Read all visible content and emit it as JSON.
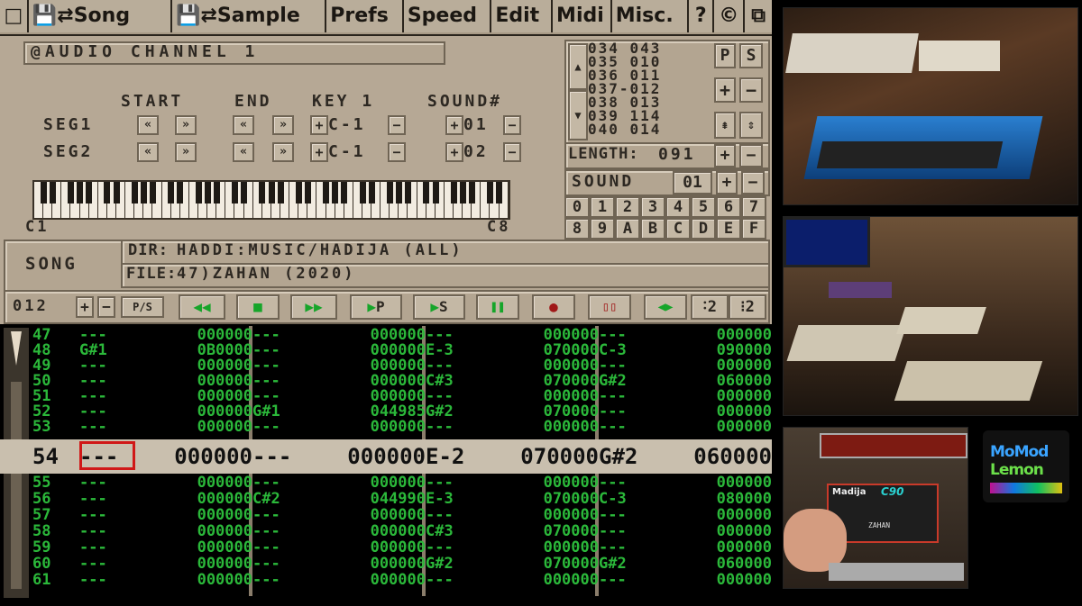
{
  "menu": [
    "□",
    "💾⇄Song",
    "💾⇄Sample",
    "Prefs",
    "Speed",
    "Edit",
    "Midi",
    "Misc.",
    "?",
    "©",
    "⧉"
  ],
  "channel_title": "@AUDIO CHANNEL 1",
  "positions": [
    "034 043",
    "035 010",
    "036 011",
    "037-012",
    "038 013",
    "039 114",
    "040 014"
  ],
  "pos_buttons": {
    "p": "P",
    "s": "S",
    "plus": "+",
    "minus": "−"
  },
  "length": {
    "label": "LENGTH:",
    "value": "091"
  },
  "sound": {
    "label": "SOUND",
    "value": "01"
  },
  "hex_row1": [
    "0",
    "1",
    "2",
    "3",
    "4",
    "5",
    "6",
    "7"
  ],
  "hex_row2": [
    "8",
    "9",
    "A",
    "B",
    "C",
    "D",
    "E",
    "F"
  ],
  "seg_headers": {
    "start": "START",
    "end": "END",
    "key": "KEY 1",
    "sound": "SOUND#"
  },
  "segments": [
    {
      "label": "SEG1",
      "key": "C-1",
      "sound": "01"
    },
    {
      "label": "SEG2",
      "key": "C-1",
      "sound": "02"
    }
  ],
  "keyboard": {
    "left": "C1",
    "right": "C8"
  },
  "song": {
    "label": "SONG",
    "dir_label": "DIR:",
    "dir": "HADDI:MUSIC/HADIJA (ALL)",
    "file_label": "FILE:",
    "file": "47)ZAHAN (2020)"
  },
  "transport": {
    "counter": "012",
    "ps": "P/S",
    "play_p": "P",
    "play_s": "S",
    "tracks": "2",
    "tracks2": "2"
  },
  "pattern_rows": [
    {
      "n": "47",
      "c": [
        [
          "---",
          "000000"
        ],
        [
          "---",
          "000000"
        ],
        [
          "---",
          "000000"
        ],
        [
          "---",
          "000000"
        ]
      ]
    },
    {
      "n": "48",
      "c": [
        [
          "G#1",
          "0B0000"
        ],
        [
          "---",
          "000000"
        ],
        [
          "E-3",
          "070000"
        ],
        [
          "C-3",
          "090000"
        ]
      ]
    },
    {
      "n": "49",
      "c": [
        [
          "---",
          "000000"
        ],
        [
          "---",
          "000000"
        ],
        [
          "---",
          "000000"
        ],
        [
          "---",
          "000000"
        ]
      ]
    },
    {
      "n": "50",
      "c": [
        [
          "---",
          "000000"
        ],
        [
          "---",
          "000000"
        ],
        [
          "C#3",
          "070000"
        ],
        [
          "G#2",
          "060000"
        ]
      ]
    },
    {
      "n": "51",
      "c": [
        [
          "---",
          "000000"
        ],
        [
          "---",
          "000000"
        ],
        [
          "---",
          "000000"
        ],
        [
          "---",
          "000000"
        ]
      ]
    },
    {
      "n": "52",
      "c": [
        [
          "---",
          "000000"
        ],
        [
          "G#1",
          "044985"
        ],
        [
          "G#2",
          "070000"
        ],
        [
          "---",
          "000000"
        ]
      ]
    },
    {
      "n": "53",
      "c": [
        [
          "---",
          "000000"
        ],
        [
          "---",
          "000000"
        ],
        [
          "---",
          "000000"
        ],
        [
          "---",
          "000000"
        ]
      ]
    }
  ],
  "current_row": {
    "n": "54",
    "c": [
      [
        "---",
        "000000"
      ],
      [
        "---",
        "000000"
      ],
      [
        "E-2",
        "070000"
      ],
      [
        "G#2",
        "060000"
      ]
    ]
  },
  "pattern_rows_after": [
    {
      "n": "55",
      "c": [
        [
          "---",
          "000000"
        ],
        [
          "---",
          "000000"
        ],
        [
          "---",
          "000000"
        ],
        [
          "---",
          "000000"
        ]
      ]
    },
    {
      "n": "56",
      "c": [
        [
          "---",
          "000000"
        ],
        [
          "C#2",
          "044990"
        ],
        [
          "E-3",
          "070000"
        ],
        [
          "C-3",
          "080000"
        ]
      ]
    },
    {
      "n": "57",
      "c": [
        [
          "---",
          "000000"
        ],
        [
          "---",
          "000000"
        ],
        [
          "---",
          "000000"
        ],
        [
          "---",
          "000000"
        ]
      ]
    },
    {
      "n": "58",
      "c": [
        [
          "---",
          "000000"
        ],
        [
          "---",
          "000000"
        ],
        [
          "C#3",
          "070000"
        ],
        [
          "---",
          "000000"
        ]
      ]
    },
    {
      "n": "59",
      "c": [
        [
          "---",
          "000000"
        ],
        [
          "---",
          "000000"
        ],
        [
          "---",
          "000000"
        ],
        [
          "---",
          "000000"
        ]
      ]
    },
    {
      "n": "60",
      "c": [
        [
          "---",
          "000000"
        ],
        [
          "---",
          "000000"
        ],
        [
          "G#2",
          "070000"
        ],
        [
          "G#2",
          "060000"
        ]
      ]
    },
    {
      "n": "61",
      "c": [
        [
          "---",
          "000000"
        ],
        [
          "---",
          "000000"
        ],
        [
          "---",
          "000000"
        ],
        [
          "---",
          "000000"
        ]
      ]
    }
  ],
  "cassette": {
    "brand": "Madija",
    "model": "C90",
    "title": "ZAHAN"
  },
  "logo": {
    "line1": "MoMod",
    "line2": "Lemon"
  }
}
